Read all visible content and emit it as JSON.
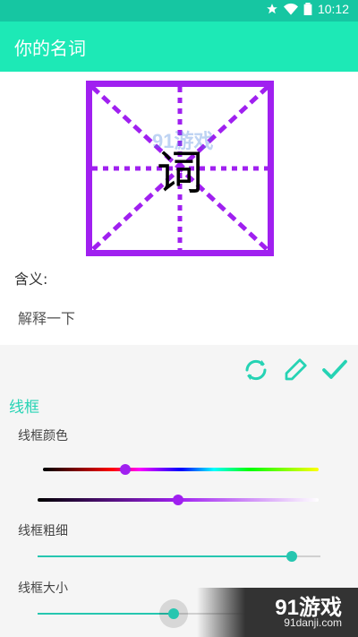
{
  "status_bar": {
    "time": "10:12",
    "icons": [
      "star-icon",
      "wifi-icon",
      "battery-icon"
    ]
  },
  "app_bar": {
    "title": "你的名词"
  },
  "character": {
    "glyph": "词",
    "watermark": "91游戏"
  },
  "meaning": {
    "label": "含义:",
    "text": "解释一下"
  },
  "actions": [
    "refresh-icon",
    "edit-icon",
    "check-icon"
  ],
  "border_section": {
    "title": "线框",
    "color_label": "线框颜色",
    "thickness_label": "线框粗细",
    "size_label": "线框大小",
    "hue_value": 0.3,
    "shade_value": 0.5,
    "thickness_value": 0.9,
    "size_value": 0.48
  },
  "colors": {
    "accent": "#1de9b6",
    "status": "#16c6a2",
    "grid": "#a020f0",
    "slider": "#26c6b0"
  },
  "watermark": {
    "brand": "91游戏",
    "url": "91danji.com"
  }
}
